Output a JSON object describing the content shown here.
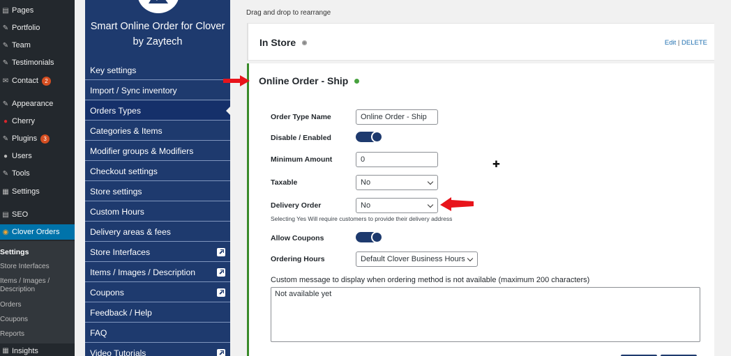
{
  "wp_menu": {
    "items": [
      {
        "label": "Pages",
        "icon": "pages-icon"
      },
      {
        "label": "Portfolio",
        "icon": "portfolio-icon"
      },
      {
        "label": "Team",
        "icon": "team-icon"
      },
      {
        "label": "Testimonials",
        "icon": "testimonials-icon"
      },
      {
        "label": "Contact",
        "icon": "contact-icon",
        "badge": "2"
      },
      {
        "label": "Appearance",
        "icon": "appearance-icon"
      },
      {
        "label": "Cherry",
        "icon": "cherry-icon"
      },
      {
        "label": "Plugins",
        "icon": "plugins-icon",
        "badge": "3"
      },
      {
        "label": "Users",
        "icon": "users-icon"
      },
      {
        "label": "Tools",
        "icon": "tools-icon"
      },
      {
        "label": "Settings",
        "icon": "settings-icon"
      },
      {
        "label": "SEO",
        "icon": "seo-icon"
      },
      {
        "label": "Clover Orders",
        "icon": "clover-icon",
        "active": true
      }
    ],
    "subitems": [
      "Settings",
      "Store Interfaces",
      "Items / Images / Description",
      "Orders",
      "Coupons",
      "Reports"
    ],
    "bottom_item": "Insights"
  },
  "plugin": {
    "brand_line1": "Smart Online Order for Clover",
    "brand_line2": "by Zaytech",
    "menu": [
      {
        "label": "Key settings"
      },
      {
        "label": "Import / Sync inventory"
      },
      {
        "label": "Orders Types",
        "selected": true
      },
      {
        "label": "Categories & Items"
      },
      {
        "label": "Modifier groups & Modifiers"
      },
      {
        "label": "Checkout settings"
      },
      {
        "label": "Store settings"
      },
      {
        "label": "Custom Hours"
      },
      {
        "label": "Delivery areas & fees"
      },
      {
        "label": "Store Interfaces",
        "external": true
      },
      {
        "label": "Items / Images / Description",
        "external": true
      },
      {
        "label": "Coupons",
        "external": true
      },
      {
        "label": "Feedback / Help"
      },
      {
        "label": "FAQ"
      },
      {
        "label": "Video Tutorials",
        "external": true
      }
    ]
  },
  "main": {
    "hint": "Drag and drop to rearrange",
    "store_card": {
      "title": "In Store",
      "status": "inactive",
      "edit_label": "Edit",
      "separator": "|",
      "delete_label": "DELETE"
    },
    "ship_card": {
      "title": "Online Order - Ship",
      "status": "active",
      "order_type_name_label": "Order Type Name",
      "order_type_name_value": "Online Order - Ship",
      "enabled_label": "Disable / Enabled",
      "enabled": true,
      "min_amount_label": "Minimum Amount",
      "min_amount_value": "0",
      "taxable_label": "Taxable",
      "taxable_value": "No",
      "delivery_label": "Delivery Order",
      "delivery_value": "No",
      "delivery_help": "Selecting Yes Will require customers to provide their delivery address",
      "coupons_label": "Allow Coupons",
      "coupons_enabled": true,
      "hours_label": "Ordering Hours",
      "hours_value": "Default Clover Business Hours",
      "message_label": "Custom message to display when ordering method is not available (maximum 200 characters)",
      "message_value": "Not available yet"
    }
  },
  "colors": {
    "wp_sidebar": "#23282d",
    "wp_active": "#0073aa",
    "plugin_navy": "#1e3a6e",
    "active_border": "#3a8a2a",
    "annotation_arrow": "#e8141b"
  }
}
